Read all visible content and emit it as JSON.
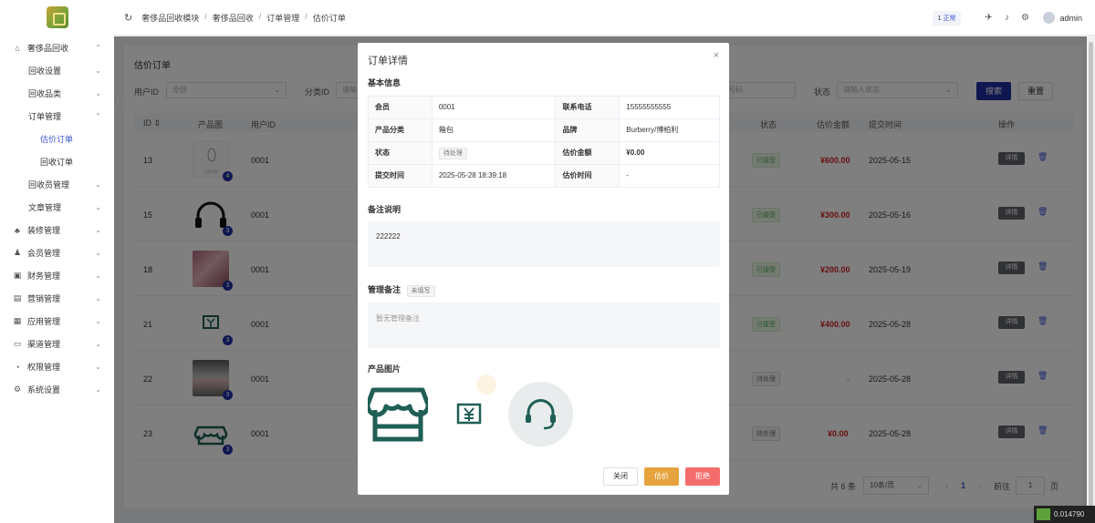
{
  "sidebar": {
    "items": [
      {
        "label": "奢侈品回收",
        "icon": "home-icon",
        "chev": "⌃",
        "level": 0
      },
      {
        "label": "回收设置",
        "icon": "",
        "chev": "⌄",
        "level": 1
      },
      {
        "label": "回收品类",
        "icon": "",
        "chev": "⌄",
        "level": 1
      },
      {
        "label": "订单管理",
        "icon": "",
        "chev": "⌃",
        "level": 1
      },
      {
        "label": "估价订单",
        "icon": "",
        "chev": "",
        "level": 2,
        "active": true
      },
      {
        "label": "回收订单",
        "icon": "",
        "chev": "",
        "level": 2
      },
      {
        "label": "回收员管理",
        "icon": "",
        "chev": "⌄",
        "level": 1
      },
      {
        "label": "文章管理",
        "icon": "",
        "chev": "⌄",
        "level": 1
      },
      {
        "label": "装修管理",
        "icon": "palette-icon",
        "chev": "⌄",
        "level": 0
      },
      {
        "label": "会员管理",
        "icon": "user-icon",
        "chev": "⌄",
        "level": 0
      },
      {
        "label": "财务管理",
        "icon": "finance-icon",
        "chev": "⌄",
        "level": 0
      },
      {
        "label": "营销管理",
        "icon": "marketing-icon",
        "chev": "⌄",
        "level": 0
      },
      {
        "label": "应用管理",
        "icon": "apps-icon",
        "chev": "⌄",
        "level": 0
      },
      {
        "label": "渠道管理",
        "icon": "channel-icon",
        "chev": "⌄",
        "level": 0
      },
      {
        "label": "权限管理",
        "icon": "lock-icon",
        "chev": "⌄",
        "level": 0
      },
      {
        "label": "系统设置",
        "icon": "gear-icon",
        "chev": "⌄",
        "level": 0
      }
    ]
  },
  "topbar": {
    "breadcrumb": [
      "奢侈品回收模块",
      "奢侈品回收",
      "订单管理",
      "估价订单"
    ],
    "unit_count": "1",
    "unit_label": "正常",
    "user": "admin"
  },
  "page": {
    "title": "估价订单",
    "filters": {
      "user_label": "用户ID",
      "user_value": "全部",
      "category_label": "分类ID",
      "category_placeholder": "请输",
      "phone_placeholder": "号码",
      "status_label": "状态",
      "status_placeholder": "请输入状态"
    },
    "search_label": "搜索",
    "reset_label": "重置",
    "columns": {
      "id": "ID ⇕",
      "image": "产品图",
      "user": "用户ID",
      "status": "状态",
      "amount": "估价金额",
      "submit_time": "提交时间",
      "action": "操作"
    },
    "rows": [
      {
        "id": "13",
        "count": "4",
        "user": "0001",
        "status": "已接受",
        "status_kind": "ok",
        "amount": "¥600.00",
        "time": "2025-05-15",
        "thumb": "paper"
      },
      {
        "id": "15",
        "count": "3",
        "user": "0001",
        "status": "已接受",
        "status_kind": "ok",
        "amount": "¥300.00",
        "time": "2025-05-16",
        "thumb": "headphones"
      },
      {
        "id": "18",
        "count": "3",
        "user": "0001",
        "status": "已接受",
        "status_kind": "ok",
        "amount": "¥200.00",
        "time": "2025-05-19",
        "thumb": "photo-pink"
      },
      {
        "id": "21",
        "count": "3",
        "user": "0001",
        "status": "已接受",
        "status_kind": "ok",
        "amount": "¥400.00",
        "time": "2025-05-28",
        "thumb": "yen-box"
      },
      {
        "id": "22",
        "count": "3",
        "user": "0001",
        "status": "待处理",
        "status_kind": "wait",
        "amount": "-",
        "time": "2025-05-28",
        "thumb": "photo-gray"
      },
      {
        "id": "23",
        "count": "3",
        "user": "0001",
        "status": "待处理",
        "status_kind": "wait",
        "amount": "¥0.00",
        "time": "2025-05-28",
        "thumb": "store"
      }
    ],
    "detail_label": "详情",
    "pager": {
      "total": "共 6 条",
      "page_size": "10条/页",
      "current": "1",
      "goto_label": "前往",
      "goto_value": "1",
      "page_suffix": "页"
    }
  },
  "modal": {
    "title": "订单详情",
    "basic_title": "基本信息",
    "basic": [
      {
        "k1": "会员",
        "v1": "0001",
        "k2": "联系电话",
        "v2": "15555555555"
      },
      {
        "k1": "产品分类",
        "v1": "箱包",
        "k2": "品牌",
        "v2": "Burberry/博柏利"
      },
      {
        "k1": "状态",
        "v1": "待处理",
        "k2": "估价金额",
        "v2": "¥0.00"
      },
      {
        "k1": "提交时间",
        "v1": "2025-05-28 18:39:18",
        "k2": "估价时间",
        "v2": "-"
      }
    ],
    "remark_title": "备注说明",
    "remark": "222222",
    "admin_note_title": "管理备注",
    "admin_note_tag": "未填写",
    "admin_note": "暂无管理备注",
    "images_title": "产品图片",
    "btn_close": "关闭",
    "btn_estimate": "估价",
    "btn_reject": "拒绝"
  },
  "watermark": "https://www.huzhan.com/ishop32121",
  "corner_badge": "0.014790",
  "colors": {
    "primary": "#1f2fa3",
    "danger": "#d01f1f",
    "estimate": "#e6a23c",
    "reject": "#f56c6c",
    "brand_green": "#1f5f55"
  }
}
